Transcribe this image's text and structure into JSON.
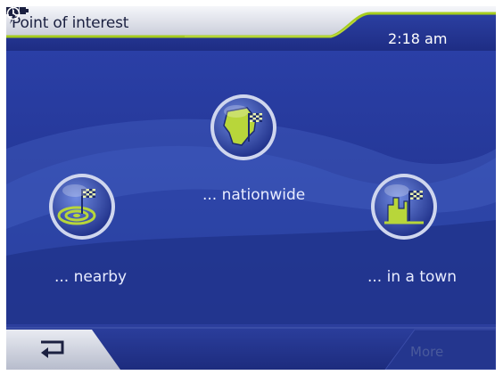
{
  "header": {
    "title": "Point of interest",
    "time": "2:18 am",
    "icons": [
      "power-icon",
      "battery-icon",
      "clock-icon"
    ]
  },
  "options": {
    "nationwide": {
      "label": "... nationwide",
      "icon": "nationwide-flag-icon"
    },
    "nearby": {
      "label": "... nearby",
      "icon": "nearby-flag-icon"
    },
    "in_town": {
      "label": "... in a town",
      "icon": "town-flag-icon"
    }
  },
  "bottom": {
    "back_icon": "back-arrow-icon",
    "more_label": "More"
  },
  "colors": {
    "background": "#25389a",
    "accent": "#a6cc1d",
    "header": "#e6e8ef"
  }
}
